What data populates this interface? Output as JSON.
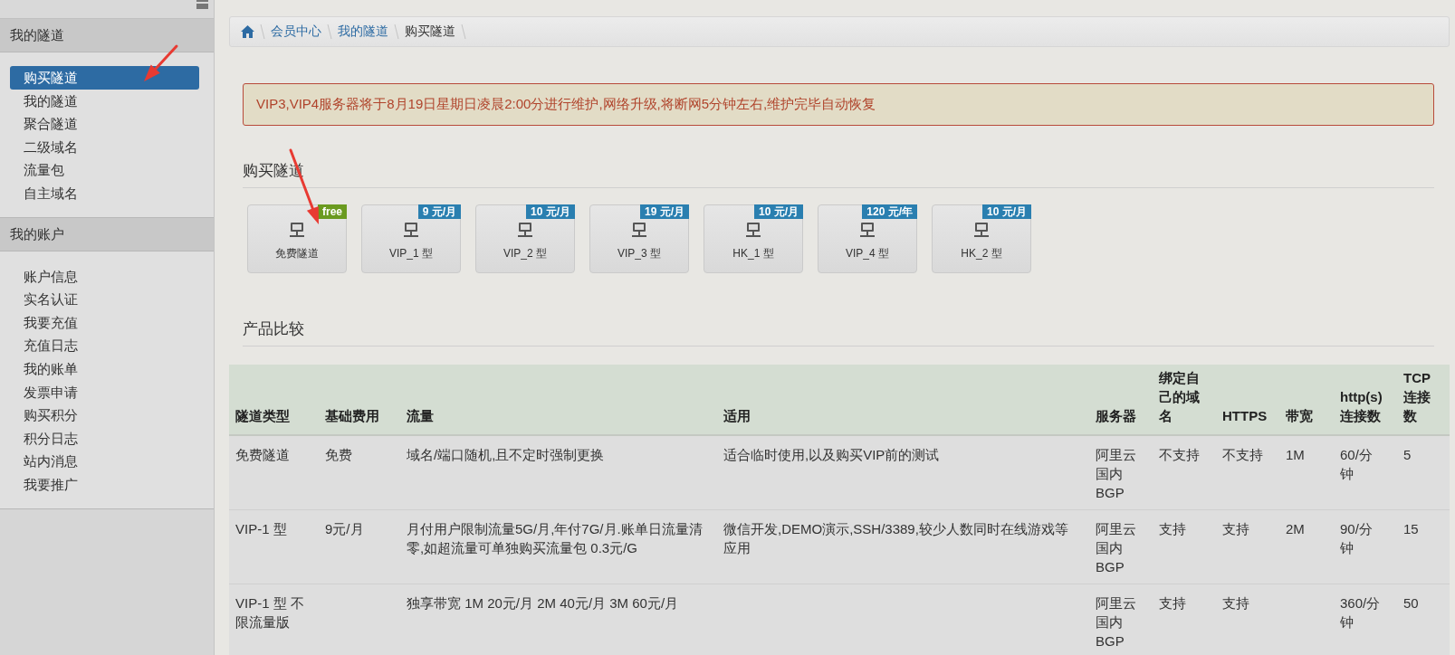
{
  "sidebar": {
    "sections": [
      {
        "title": "我的隧道",
        "items": [
          {
            "label": "购买隧道",
            "selected": true
          },
          {
            "label": "我的隧道",
            "selected": false
          },
          {
            "label": "聚合隧道",
            "selected": false
          },
          {
            "label": "二级域名",
            "selected": false
          },
          {
            "label": "流量包",
            "selected": false
          },
          {
            "label": "自主域名",
            "selected": false
          }
        ]
      },
      {
        "title": "我的账户",
        "items": [
          {
            "label": "账户信息",
            "selected": false
          },
          {
            "label": "实名认证",
            "selected": false
          },
          {
            "label": "我要充值",
            "selected": false
          },
          {
            "label": "充值日志",
            "selected": false
          },
          {
            "label": "我的账单",
            "selected": false
          },
          {
            "label": "发票申请",
            "selected": false
          },
          {
            "label": "购买积分",
            "selected": false
          },
          {
            "label": "积分日志",
            "selected": false
          },
          {
            "label": "站内消息",
            "selected": false
          },
          {
            "label": "我要推广",
            "selected": false
          }
        ]
      }
    ]
  },
  "breadcrumb": [
    {
      "label": "会员中心",
      "current": false
    },
    {
      "label": "我的隧道",
      "current": false
    },
    {
      "label": "购买隧道",
      "current": true
    }
  ],
  "alert": "VIP3,VIP4服务器将于8月19日星期日凌晨2:00分进行维护,网络升级,将断网5分钟左右,维护完毕自动恢复",
  "buy": {
    "title": "购买隧道",
    "products": [
      {
        "name": "免费隧道",
        "badge": "free",
        "color": "#6a9a1f"
      },
      {
        "name": "VIP_1 型",
        "badge": "9 元/月",
        "color": "#2a7fb0"
      },
      {
        "name": "VIP_2 型",
        "badge": "10 元/月",
        "color": "#2a7fb0"
      },
      {
        "name": "VIP_3 型",
        "badge": "19 元/月",
        "color": "#2a7fb0"
      },
      {
        "name": "HK_1 型",
        "badge": "10 元/月",
        "color": "#2a7fb0"
      },
      {
        "name": "VIP_4 型",
        "badge": "120 元/年",
        "color": "#2a7fb0"
      },
      {
        "name": "HK_2 型",
        "badge": "10 元/月",
        "color": "#2a7fb0"
      }
    ]
  },
  "compare": {
    "title": "产品比较",
    "columns": [
      "隧道类型",
      "基础费用",
      "流量",
      "适用",
      "服务器",
      "绑定自己的域名",
      "HTTPS",
      "带宽",
      "http(s)连接数",
      "TCP连接数"
    ],
    "rows": [
      [
        "免费隧道",
        "免费",
        "域名/端口随机,且不定时强制更换",
        "适合临时使用,以及购买VIP前的测试",
        "阿里云国内BGP",
        "不支持",
        "不支持",
        "1M",
        "60/分钟",
        "5"
      ],
      [
        "VIP-1 型",
        "9元/月",
        "月付用户限制流量5G/月,年付7G/月.账单日流量清零,如超流量可单独购买流量包 0.3元/G",
        "微信开发,DEMO演示,SSH/3389,较少人数同时在线游戏等应用",
        "阿里云国内BGP",
        "支持",
        "支持",
        "2M",
        "90/分钟",
        "15"
      ],
      [
        "VIP-1 型 不限流量版",
        null,
        "独享带宽 1M 20元/月 2M 40元/月 3M 60元/月",
        null,
        "阿里云国内BGP",
        "支持",
        "支持",
        null,
        "360/分钟",
        "50"
      ]
    ]
  }
}
